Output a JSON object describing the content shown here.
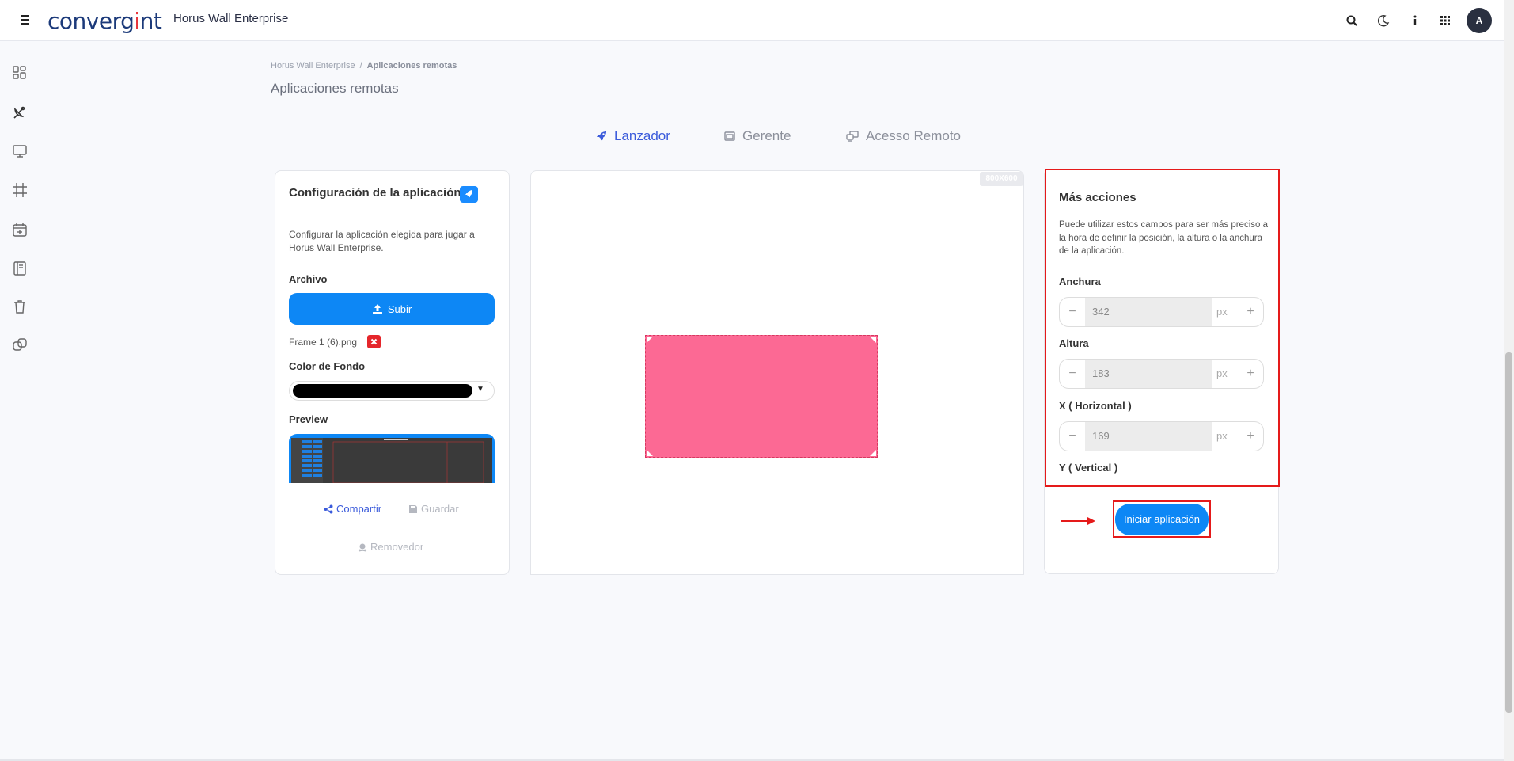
{
  "header": {
    "logo_text": "convergint",
    "app_title": "Horus Wall Enterprise",
    "avatar_initial": "A",
    "icons": [
      "menu-icon",
      "search-icon",
      "moon-icon",
      "info-icon",
      "apps-grid-icon"
    ]
  },
  "sidebar": {
    "items": [
      {
        "name": "dashboard",
        "icon": "dashboard-icon"
      },
      {
        "name": "remote-apps",
        "icon": "satellite-dish-icon"
      },
      {
        "name": "displays",
        "icon": "monitor-icon"
      },
      {
        "name": "frames",
        "icon": "crop-icon"
      },
      {
        "name": "schedule",
        "icon": "calendar-add-icon"
      },
      {
        "name": "logs",
        "icon": "book-icon"
      },
      {
        "name": "trash",
        "icon": "trash-icon"
      },
      {
        "name": "integrations",
        "icon": "link-icon"
      }
    ]
  },
  "breadcrumb": {
    "root": "Horus Wall Enterprise",
    "separator": "/",
    "current": "Aplicaciones remotas"
  },
  "page_title": "Aplicaciones remotas",
  "tabs": [
    {
      "label": "Lanzador",
      "icon": "rocket-icon",
      "active": true
    },
    {
      "label": "Gerente",
      "icon": "window-icon",
      "active": false
    },
    {
      "label": "Acesso Remoto",
      "icon": "remote-desktop-icon",
      "active": false
    }
  ],
  "config_panel": {
    "title": "Configuración de la aplicación",
    "description": "Configurar la aplicación elegida para jugar a Horus Wall Enterprise.",
    "file_label": "Archivo",
    "upload_label": "Subir",
    "file_name": "Frame 1 (6).png",
    "bg_color_label": "Color de Fondo",
    "bg_color_value": "#000000",
    "preview_label": "Preview",
    "share_label": "Compartir",
    "save_label": "Guardar",
    "remove_label": "Removedor"
  },
  "canvas": {
    "resolution": "800X600",
    "app_color": "#fc6994"
  },
  "more_actions": {
    "title": "Más acciones",
    "description": "Puede utilizar estos campos para ser más preciso a la hora de definir la posición, la altura o la anchura de la aplicación.",
    "fields": [
      {
        "label": "Anchura",
        "value": "342",
        "unit": "px"
      },
      {
        "label": "Altura",
        "value": "183",
        "unit": "px"
      },
      {
        "label": "X ( Horizontal )",
        "value": "169",
        "unit": "px"
      },
      {
        "label": "Y ( Vertical )"
      }
    ],
    "start_button": "Iniciar aplicación"
  },
  "colors": {
    "accent": "#3b5bdb",
    "primary_button": "#0d87f5",
    "highlight": "#e51a1a",
    "danger": "#e5262b"
  }
}
